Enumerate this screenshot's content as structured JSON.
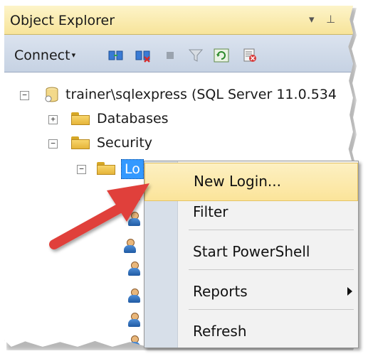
{
  "panel": {
    "title": "Object Explorer",
    "title_controls": [
      "▾",
      "⊥"
    ]
  },
  "toolbar": {
    "connect_label": "Connect",
    "caret": "▾",
    "icons": [
      "connect-object-explorer-icon",
      "disconnect-icon",
      "stop-icon",
      "filter-icon",
      "refresh-icon",
      "activity-monitor-icon"
    ]
  },
  "tree": {
    "server_label": "trainer\\sqlexpress (SQL Server 11.0.534",
    "databases_label": "Databases",
    "security_label": "Security",
    "logins_label": "Lo",
    "expand_glyph": "+",
    "collapse_glyph": "−"
  },
  "context_menu": {
    "items": [
      {
        "label": "New Login..."
      },
      {
        "label": "Filter"
      },
      {
        "label": "Start PowerShell"
      },
      {
        "label": "Reports"
      },
      {
        "label": "Refresh"
      }
    ]
  },
  "colors": {
    "annotation_arrow": "#e0403a",
    "selection": "#3399ff",
    "menu_hover": "#fbe49a"
  }
}
